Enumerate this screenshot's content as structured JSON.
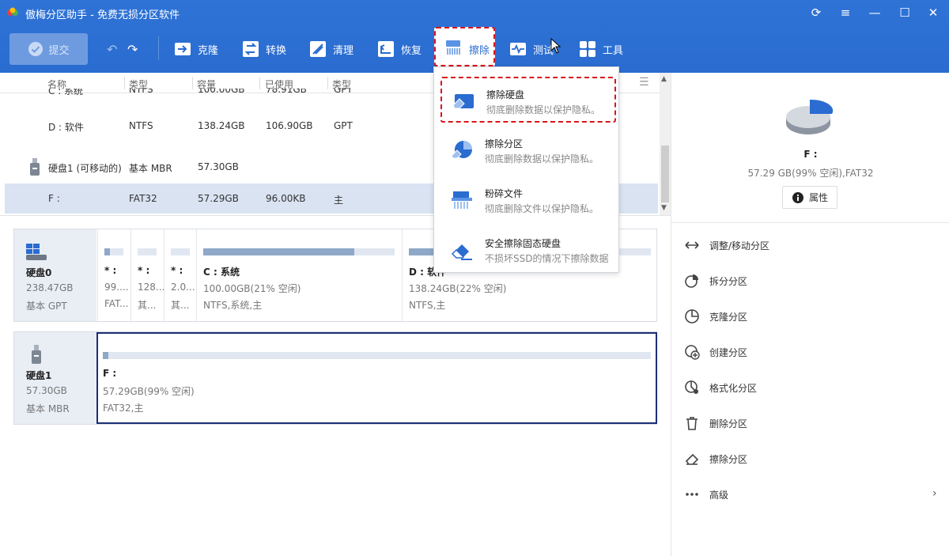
{
  "window": {
    "title": "傲梅分区助手 - 免费无损分区软件",
    "controls": {
      "refresh": "⟳",
      "menu": "≡",
      "minimize": "—",
      "maximize": "☐",
      "close": "✕"
    }
  },
  "toolbar": {
    "submit": "提交",
    "clone": "克隆",
    "convert": "转换",
    "clean": "清理",
    "recover": "恢复",
    "wipe": "擦除",
    "test": "测试",
    "tools": "工具"
  },
  "wipe_menu": {
    "items": [
      {
        "title": "擦除硬盘",
        "desc": "彻底删除数据以保护隐私。"
      },
      {
        "title": "擦除分区",
        "desc": "彻底删除数据以保护隐私。"
      },
      {
        "title": "粉碎文件",
        "desc": "彻底删除文件以保护隐私。"
      },
      {
        "title": "安全擦除固态硬盘",
        "desc": "不损坏SSD的情况下擦除数据"
      }
    ]
  },
  "table": {
    "headers": {
      "name": "名称",
      "type": "类型",
      "capacity": "容量",
      "used": "已使用",
      "ptype": "类型"
    },
    "rows": [
      {
        "name": "C : 系统",
        "type": "NTFS",
        "capacity": "100.00GB",
        "used": "78.91GB",
        "ptype": "GPT"
      },
      {
        "name": "D : 软件",
        "type": "NTFS",
        "capacity": "138.24GB",
        "used": "106.90GB",
        "ptype": "GPT"
      },
      {
        "name": "硬盘1 (可移动的)",
        "type": "基本 MBR",
        "capacity": "57.30GB",
        "used": "",
        "ptype": ""
      },
      {
        "name": "F :",
        "type": "FAT32",
        "capacity": "57.29GB",
        "used": "96.00KB",
        "ptype": "主"
      }
    ]
  },
  "disks": [
    {
      "name": "硬盘0",
      "size": "238.47GB",
      "style": "基本 GPT",
      "parts": [
        {
          "t1": "* :",
          "t2": "99....",
          "t3": "FAT...",
          "used_frac": 0.3
        },
        {
          "t1": "* :",
          "t2": "128...",
          "t3": "其...",
          "used_frac": 0.0
        },
        {
          "t1": "* :",
          "t2": "2.0...",
          "t3": "其...",
          "used_frac": 0.0
        },
        {
          "t1": "C : 系统",
          "t2": "100.00GB(21% 空闲)",
          "t3": "NTFS,系统,主",
          "used_frac": 0.79
        },
        {
          "t1": "D : 软件",
          "t2": "138.24GB(22% 空闲)",
          "t3": "NTFS,主",
          "used_frac": 0.78
        }
      ]
    },
    {
      "name": "硬盘1",
      "size": "57.30GB",
      "style": "基本 MBR",
      "parts": [
        {
          "t1": "F :",
          "t2": "57.29GB(99% 空闲)",
          "t3": "FAT32,主",
          "used_frac": 0.01
        }
      ]
    }
  ],
  "right_panel": {
    "name": "F :",
    "info": "57.29 GB(99% 空闲),FAT32",
    "properties": "属性",
    "ops": [
      "调整/移动分区",
      "拆分分区",
      "克隆分区",
      "创建分区",
      "格式化分区",
      "删除分区",
      "擦除分区",
      "高级"
    ]
  },
  "colors": {
    "accent": "#2a6cd0",
    "highlight": "#d9141b",
    "selected_row": "#d9e3f2"
  }
}
